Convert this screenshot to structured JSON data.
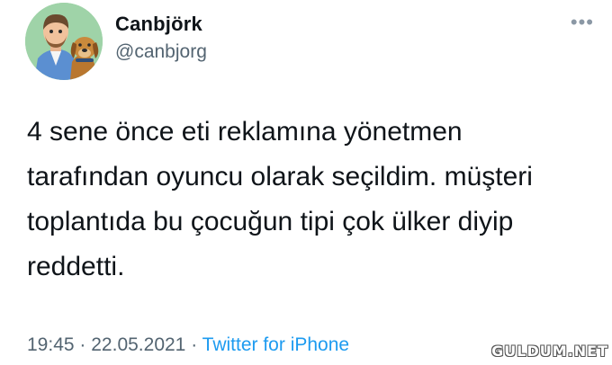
{
  "tweet": {
    "display_name": "Canbjörk",
    "handle": "@canbjorg",
    "more_icon": "more-horizontal-icon",
    "text_lines": [
      "4 sene önce eti reklamına yönetmen",
      "tarafından oyuncu olarak seçildim. müşteri",
      "toplantıda bu çocuğun tipi çok ülker diyip",
      "reddetti."
    ],
    "time": "19:45",
    "date": "22.05.2021",
    "separator": "·",
    "source": "Twitter for iPhone"
  },
  "watermark": "GULDUM.NET",
  "colors": {
    "text": "#0f1419",
    "secondary": "#536471",
    "link": "#1d9bf0",
    "avatar_bg": "#9fd3a8"
  }
}
